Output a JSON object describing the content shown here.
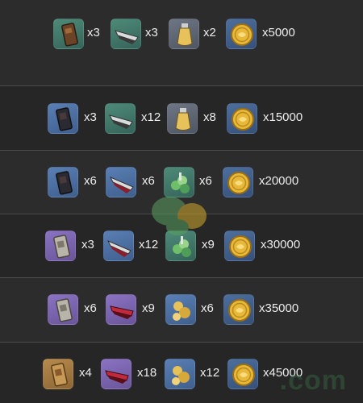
{
  "rows": [
    {
      "items": [
        {
          "icon": "talisman-brown-icon",
          "rarity": "green",
          "qty": "x3"
        },
        {
          "icon": "blade-fragment-icon",
          "rarity": "green",
          "qty": "x3"
        },
        {
          "icon": "potion-vial-icon",
          "rarity": "grey",
          "qty": "x2"
        },
        {
          "icon": "gold-coin-icon",
          "rarity": "coin",
          "qty": "x5000"
        }
      ]
    },
    {
      "items": [
        {
          "icon": "talisman-dark-icon",
          "rarity": "blue",
          "qty": "x3"
        },
        {
          "icon": "blade-fragment-icon",
          "rarity": "green",
          "qty": "x12"
        },
        {
          "icon": "potion-vial-icon",
          "rarity": "grey",
          "qty": "x8"
        },
        {
          "icon": "gold-coin-icon",
          "rarity": "coin",
          "qty": "x15000"
        }
      ]
    },
    {
      "items": [
        {
          "icon": "talisman-dark-icon",
          "rarity": "blue",
          "qty": "x6"
        },
        {
          "icon": "blade-red-icon",
          "rarity": "blue",
          "qty": "x6"
        },
        {
          "icon": "herb-cluster-icon",
          "rarity": "green",
          "qty": "x6"
        },
        {
          "icon": "gold-coin-icon",
          "rarity": "coin",
          "qty": "x20000"
        }
      ]
    },
    {
      "items": [
        {
          "icon": "talisman-silver-icon",
          "rarity": "purple",
          "qty": "x3"
        },
        {
          "icon": "blade-red-icon",
          "rarity": "blue",
          "qty": "x12"
        },
        {
          "icon": "herb-cluster-icon",
          "rarity": "green",
          "qty": "x9"
        },
        {
          "icon": "gold-coin-icon",
          "rarity": "coin",
          "qty": "x30000"
        }
      ]
    },
    {
      "items": [
        {
          "icon": "talisman-silver-icon",
          "rarity": "purple",
          "qty": "x6"
        },
        {
          "icon": "blade-crimson-icon",
          "rarity": "purple",
          "qty": "x9"
        },
        {
          "icon": "gold-ore-icon",
          "rarity": "blue",
          "qty": "x6"
        },
        {
          "icon": "gold-coin-icon",
          "rarity": "coin",
          "qty": "x35000"
        }
      ]
    },
    {
      "items": [
        {
          "icon": "talisman-gold-icon",
          "rarity": "gold",
          "qty": "x4"
        },
        {
          "icon": "blade-crimson-icon",
          "rarity": "purple",
          "qty": "x18"
        },
        {
          "icon": "gold-ore-icon",
          "rarity": "blue",
          "qty": "x12"
        },
        {
          "icon": "gold-coin-icon",
          "rarity": "coin",
          "qty": "x45000"
        }
      ]
    }
  ],
  "watermark": ".com"
}
